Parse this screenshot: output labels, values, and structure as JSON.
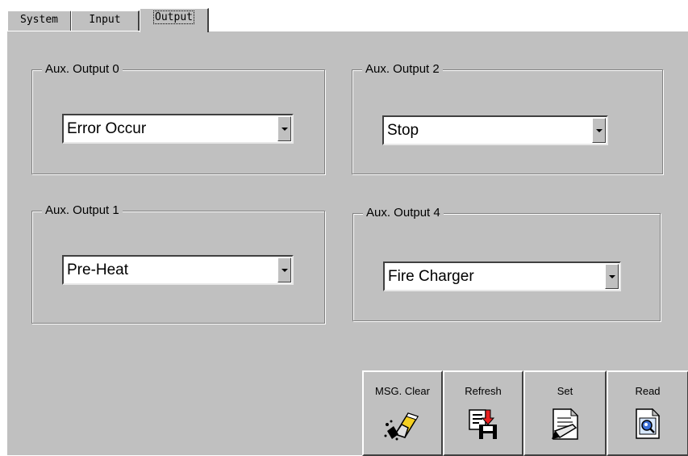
{
  "tabs": {
    "system": "System",
    "input": "Input",
    "output": "Output"
  },
  "outputs": {
    "aux0": {
      "label": "Aux. Output 0",
      "value": "Error Occur"
    },
    "aux2": {
      "label": "Aux. Output 2",
      "value": "Stop"
    },
    "aux1": {
      "label": "Aux. Output 1",
      "value": "Pre-Heat"
    },
    "aux4": {
      "label": "Aux. Output 4",
      "value": "Fire Charger"
    }
  },
  "buttons": {
    "msg_clear": {
      "label": "MSG. Clear",
      "icon": "eraser-icon"
    },
    "refresh": {
      "label": "Refresh",
      "icon": "refresh-icon"
    },
    "set": {
      "label": "Set",
      "icon": "set-icon"
    },
    "read": {
      "label": "Read",
      "icon": "read-icon"
    }
  },
  "colors": {
    "panel_bg": "#c0c0c0",
    "eraser_body": "#f5d020",
    "refresh_arrow": "#e82020"
  }
}
